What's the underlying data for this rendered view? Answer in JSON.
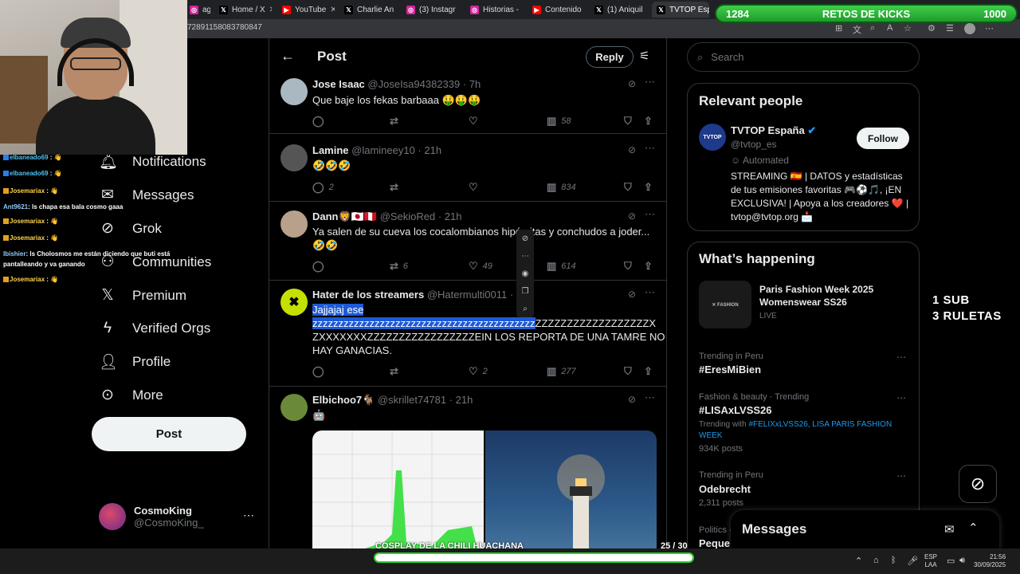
{
  "browser": {
    "tabs": [
      {
        "label": "agr",
        "icon": "instagram-icon"
      },
      {
        "label": "Home / X",
        "icon": "x-logo-icon"
      },
      {
        "label": "YouTube",
        "icon": "youtube-icon"
      },
      {
        "label": "Charlie An",
        "icon": "x-logo-icon"
      },
      {
        "label": "(3) Instagr",
        "icon": "instagram-icon"
      },
      {
        "label": "Historias -",
        "icon": "instagram-icon"
      },
      {
        "label": "Contenido",
        "icon": "youtube-icon"
      },
      {
        "label": "(1) Aniquil",
        "icon": "x-logo-icon"
      },
      {
        "label": "TVTOP Esp",
        "icon": "x-logo-icon"
      }
    ],
    "url": "72891158083780847"
  },
  "chat": [
    {
      "user": "elbaneado69",
      "msg": ":"
    },
    {
      "user": "elbaneado69",
      "msg": ":"
    },
    {
      "user": "Josemariax",
      "msg": ":"
    },
    {
      "user": "Ant9621",
      "msg": ": ls chapa esa bala cosmo gaaa"
    },
    {
      "user": "Josemariax",
      "msg": ":"
    },
    {
      "user": "Josemariax",
      "msg": ":"
    },
    {
      "user": "Ibishier",
      "msg": ": ls Cholosmos me están diciendo que buti está"
    },
    {
      "user": "",
      "msg": "pantalleando y va ganando"
    },
    {
      "user": "Josemariax",
      "msg": ":"
    }
  ],
  "nav": {
    "items": [
      {
        "label": "Notifications",
        "icon": "bell-icon"
      },
      {
        "label": "Messages",
        "icon": "mail-icon"
      },
      {
        "label": "Grok",
        "icon": "grok-icon"
      },
      {
        "label": "Communities",
        "icon": "communities-icon"
      },
      {
        "label": "Premium",
        "icon": "x-logo-icon"
      },
      {
        "label": "Verified Orgs",
        "icon": "lightning-icon"
      },
      {
        "label": "Profile",
        "icon": "person-icon"
      },
      {
        "label": "More",
        "icon": "more-circle-icon"
      }
    ],
    "post_label": "Post",
    "account": {
      "name": "CosmoKing",
      "handle": "@CosmoKing_"
    }
  },
  "header": {
    "title": "Post",
    "reply_label": "Reply"
  },
  "tweets": [
    {
      "name": "Jose Isaac",
      "handle": "@JoseIsa94382339 · 7h",
      "text": "Que baje los fekas  barbaaa 🤑🤑🤑",
      "replies": "",
      "retweets": "",
      "likes": "",
      "views": "58"
    },
    {
      "name": "Lamine",
      "handle": "@lamineey10 · 21h",
      "text": "🤣🤣🤣",
      "replies": "2",
      "retweets": "",
      "likes": "",
      "views": "834"
    },
    {
      "name": "Dann🦁🇯🇵🇵🇪",
      "handle": "@SekioRed · 21h",
      "text": "Ya salen de su cueva los cocalombianos hipócritas y conchudos a joder...",
      "text2": "🤣🤣",
      "replies": "",
      "retweets": "6",
      "likes": "49",
      "views": "614"
    },
    {
      "name": "Hater de los streamers",
      "handle": "@Hatermulti0011 · 1",
      "text_sel": "Jajjajaj ese",
      "line2_sel": "zzzzzzzzzzzzzzzzzzzzzzzzzzzzzzzzzzzzzzzzzzz",
      "line2_rest": "ZZZZZZZZZZZZZZZZZZX",
      "line3": "ZXXXXXXXZZZZZZZZZZZZZZZZZEIN LOS REPORTA DE UNA TAMRE NO",
      "line4": "HAY GANACIAS.",
      "replies": "",
      "retweets": "",
      "likes": "2",
      "views": "277"
    },
    {
      "name": "Elbichoo7🐐",
      "handle": "@skrillet74781 · 21h",
      "text": "🤖"
    }
  ],
  "search": {
    "placeholder": "Search"
  },
  "relevant": {
    "title": "Relevant people",
    "name": "TVTOP España",
    "handle": "@tvtop_es",
    "automated": "Automated",
    "follow_label": "Follow",
    "bio": "STREAMING 🇪🇸 | DATOS y estadísticas de tus emisiones favoritas 🎮⚽🎵, ¡EN EXCLUSIVA! | Apoya a los creadores ❤️ | tvtop@tvtop.org 📩"
  },
  "happening": {
    "title": "What’s happening",
    "event": {
      "title": "Paris Fashion Week 2025 Womenswear SS26",
      "status": "LIVE"
    },
    "trends": [
      {
        "label": "Trending in Peru",
        "name": "#EresMiBien"
      },
      {
        "label": "Fashion & beauty · Trending",
        "name": "#LISAxLVSS26",
        "with_prefix": "Trending with",
        "with": "#FELIXxLVSS26, LISA PARIS FASHION WEEK",
        "posts": "934K posts"
      },
      {
        "label": "Trending in Peru",
        "name": "Odebrecht",
        "posts": "2,311 posts"
      },
      {
        "label": "Politics ·",
        "name": "Peque"
      }
    ]
  },
  "messages_drawer": {
    "title": "Messages"
  },
  "overlays": {
    "retos": {
      "left": "1284",
      "label": "RETOS DE KICKS",
      "right": "1000"
    },
    "sub_line1": "1 SUB",
    "sub_line2": "3 RULETAS",
    "cosplay": {
      "label": "COSPLAY DE LA CHILI HUACHANA",
      "count": "25 / 30",
      "progress": 0.83
    }
  },
  "taskbar": {
    "lang1": "ESP",
    "lang2": "LAA",
    "time": "21:56",
    "date": "30/09/2025"
  },
  "colors": {
    "accent": "#1d9bf0",
    "progress_green": "#2bd42b"
  }
}
